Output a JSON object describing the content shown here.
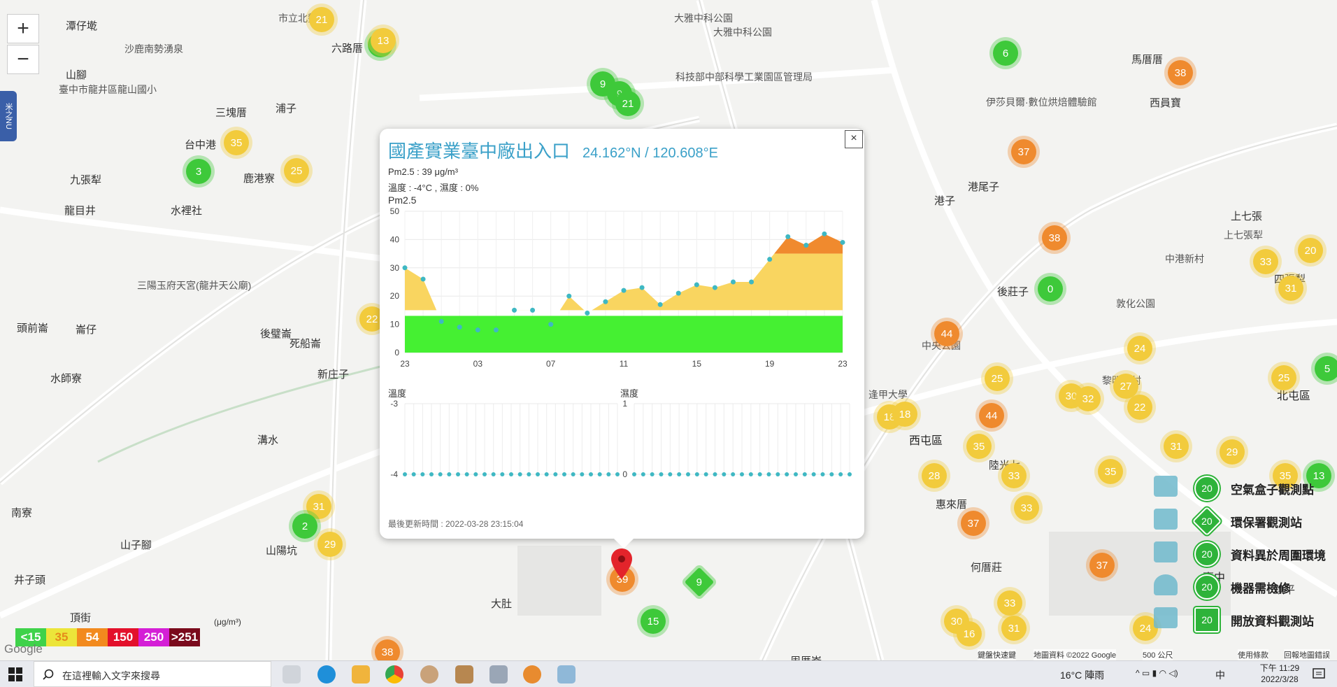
{
  "map": {
    "zoom_in": "+",
    "zoom_out": "−",
    "side_tab": "米之NU",
    "places": [
      "潭仔墘",
      "沙鹿南勢湧泉",
      "山腳",
      "臺中市龍井區龍山國小",
      "三塊厝",
      "台中港",
      "九張犁",
      "龍目井",
      "水裡社",
      "鹿港寮",
      "浦子",
      "六路厝",
      "市立北勢",
      "大雅中科公園",
      "科技部中部科學工業園區管理局",
      "大雅中科公園",
      "伊莎貝爾·數位烘焙體驗館",
      "西員寶",
      "馬厝厝",
      "港尾子",
      "港子",
      "上七張",
      "上七張犁",
      "中港新村",
      "四張犁",
      "北屯區",
      "敦化公園",
      "後莊子",
      "中央公園",
      "逢甲大學",
      "西屯區",
      "惠來厝",
      "何厝莊",
      "臺中",
      "陸光七",
      "三陽玉府天宮(龍井天公廟)",
      "新庄子",
      "死船崙",
      "後璧崙",
      "頭前崙",
      "崙仔",
      "水師寮",
      "溝水",
      "南寮",
      "山子腳",
      "山陽坑",
      "井子頭",
      "頂街",
      "大肚",
      "周厝崙",
      "黎明新村",
      "鎮平",
      "邱厝子"
    ],
    "markers": [
      {
        "v": "21",
        "c": "yellow"
      },
      {
        "v": "10",
        "c": "green"
      },
      {
        "v": "13",
        "c": "yellow"
      },
      {
        "v": "35",
        "c": "yellow"
      },
      {
        "v": "25",
        "c": "yellow"
      },
      {
        "v": "3",
        "c": "green"
      },
      {
        "v": "9",
        "c": "green"
      },
      {
        "v": "9",
        "c": "green"
      },
      {
        "v": "21",
        "c": "green"
      },
      {
        "v": "6",
        "c": "green"
      },
      {
        "v": "38",
        "c": "orange"
      },
      {
        "v": "37",
        "c": "orange"
      },
      {
        "v": "38",
        "c": "orange"
      },
      {
        "v": "0",
        "c": "green"
      },
      {
        "v": "33",
        "c": "yellow"
      },
      {
        "v": "20",
        "c": "yellow"
      },
      {
        "v": "31",
        "c": "yellow"
      },
      {
        "v": "44",
        "c": "orange"
      },
      {
        "v": "24",
        "c": "yellow"
      },
      {
        "v": "25",
        "c": "yellow"
      },
      {
        "v": "25",
        "c": "yellow"
      },
      {
        "v": "5",
        "c": "green"
      },
      {
        "v": "27",
        "c": "yellow"
      },
      {
        "v": "22",
        "c": "yellow"
      },
      {
        "v": "30",
        "c": "yellow"
      },
      {
        "v": "32",
        "c": "yellow"
      },
      {
        "v": "18",
        "c": "yellow"
      },
      {
        "v": "18",
        "c": "yellow"
      },
      {
        "v": "44",
        "c": "orange"
      },
      {
        "v": "35",
        "c": "yellow"
      },
      {
        "v": "31",
        "c": "yellow"
      },
      {
        "v": "29",
        "c": "yellow"
      },
      {
        "v": "28",
        "c": "yellow"
      },
      {
        "v": "33",
        "c": "yellow"
      },
      {
        "v": "35",
        "c": "yellow"
      },
      {
        "v": "13",
        "c": "green"
      },
      {
        "v": "37",
        "c": "orange"
      },
      {
        "v": "33",
        "c": "yellow"
      },
      {
        "v": "37",
        "c": "orange"
      },
      {
        "v": "33",
        "c": "yellow"
      },
      {
        "v": "31",
        "c": "yellow"
      },
      {
        "v": "30",
        "c": "yellow"
      },
      {
        "v": "16",
        "c": "yellow"
      },
      {
        "v": "24",
        "c": "yellow"
      },
      {
        "v": "35",
        "c": "yellow"
      },
      {
        "v": "22",
        "c": "yellow"
      },
      {
        "v": "31",
        "c": "yellow"
      },
      {
        "v": "2",
        "c": "green"
      },
      {
        "v": "29",
        "c": "yellow"
      },
      {
        "v": "39",
        "c": "orange"
      },
      {
        "v": "15",
        "c": "green"
      },
      {
        "v": "38",
        "c": "orange"
      }
    ],
    "diamond_marker": "9"
  },
  "popup": {
    "close": "×",
    "title": "國產實業臺中廠出入口",
    "coord": "24.162°N / 120.608°E",
    "pm25_line": "Pm2.5 : 39 μg/m³",
    "temp_hum_line": "溫度 : -4°C , 濕度 : 0%",
    "pm25_label": "Pm2.5",
    "temp_label": "溫度",
    "hum_label": "濕度",
    "updated": "最後更新時間 : 2022-03-28 23:15:04"
  },
  "chart_data": [
    {
      "type": "area",
      "title": "Pm2.5",
      "x_ticks": [
        "23",
        "03",
        "07",
        "11",
        "15",
        "19",
        "23"
      ],
      "y_ticks": [
        0,
        10,
        20,
        30,
        40,
        50
      ],
      "ylim": [
        0,
        50
      ],
      "values": [
        30,
        26,
        11,
        9,
        8,
        8,
        15,
        15,
        10,
        20,
        14,
        18,
        22,
        23,
        17,
        21,
        24,
        23,
        25,
        25,
        33,
        41,
        38,
        42,
        39
      ],
      "colors": {
        "low": "#45f032",
        "mid": "#f9d560",
        "high": "#f08a2e"
      }
    },
    {
      "type": "line",
      "title": "溫度",
      "y_ticks": [
        -3,
        -4
      ],
      "ylim": [
        -4,
        -3
      ],
      "values": [
        -4,
        -4,
        -4,
        -4,
        -4,
        -4,
        -4,
        -4,
        -4,
        -4,
        -4,
        -4,
        -4,
        -4,
        -4,
        -4,
        -4,
        -4,
        -4,
        -4,
        -4,
        -4,
        -4,
        -4,
        -4
      ]
    },
    {
      "type": "line",
      "title": "濕度",
      "y_ticks": [
        1,
        0
      ],
      "ylim": [
        0,
        1
      ],
      "values": [
        0,
        0,
        0,
        0,
        0,
        0,
        0,
        0,
        0,
        0,
        0,
        0,
        0,
        0,
        0,
        0,
        0,
        0,
        0,
        0,
        0,
        0,
        0,
        0,
        0
      ]
    }
  ],
  "legend": {
    "badge": "20",
    "items": [
      "空氣盒子觀測點",
      "環保署觀測站",
      "資料異於周圍環境",
      "機器需檢修",
      "開放資料觀測站"
    ]
  },
  "scale": {
    "items": [
      {
        "label": "<15",
        "color": "#3fd24a"
      },
      {
        "label": "35",
        "color": "#ece53a"
      },
      {
        "label": "54",
        "color": "#f28a1e"
      },
      {
        "label": "150",
        "color": "#e3102b"
      },
      {
        "label": "250",
        "color": "#d41fd6"
      },
      {
        "label": ">251",
        "color": "#7a0a1c"
      }
    ],
    "unit": "(μg/m³)"
  },
  "attribution": {
    "google": "Google",
    "shortcuts": "鍵盤快速鍵",
    "mapdata": "地圖資料 ©2022 Google",
    "scale": "500 公尺",
    "terms": "使用條款",
    "report": "回報地圖錯誤"
  },
  "taskbar": {
    "search_placeholder": "在這裡輸入文字來搜尋",
    "weather": "16°C 陣雨",
    "ime": "中",
    "time": "下午 11:29",
    "date": "2022/3/28"
  }
}
